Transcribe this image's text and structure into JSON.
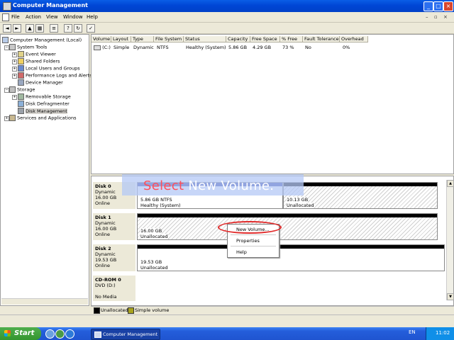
{
  "window": {
    "title": "Computer Management"
  },
  "menu": {
    "items": [
      "File",
      "Action",
      "View",
      "Window",
      "Help"
    ]
  },
  "tree": {
    "root": "Computer Management (Local)",
    "items": [
      {
        "label": "System Tools"
      },
      {
        "label": "Event Viewer"
      },
      {
        "label": "Shared Folders"
      },
      {
        "label": "Local Users and Groups"
      },
      {
        "label": "Performance Logs and Alerts"
      },
      {
        "label": "Device Manager"
      },
      {
        "label": "Storage"
      },
      {
        "label": "Removable Storage"
      },
      {
        "label": "Disk Defragmenter"
      },
      {
        "label": "Disk Management"
      },
      {
        "label": "Services and Applications"
      }
    ]
  },
  "volumes": {
    "headers": [
      "Volume",
      "Layout",
      "Type",
      "File System",
      "Status",
      "Capacity",
      "Free Space",
      "% Free",
      "Fault Tolerance",
      "Overhead"
    ],
    "rows": [
      [
        "(C:)",
        "Simple",
        "Dynamic",
        "NTFS",
        "Healthy (System)",
        "5.86 GB",
        "4.29 GB",
        "73 %",
        "No",
        "0%"
      ]
    ]
  },
  "disks": [
    {
      "name": "Disk 0",
      "type": "Dynamic",
      "size": "16.00 GB",
      "status": "Online",
      "partitions": [
        {
          "line1": "5.86 GB NTFS",
          "line2": "Healthy (System)"
        },
        {
          "line1": "10.13 GB",
          "line2": "Unallocated"
        }
      ]
    },
    {
      "name": "Disk 1",
      "type": "Dynamic",
      "size": "16.00 GB",
      "status": "Online",
      "partitions": [
        {
          "line1": "16.00 GB",
          "line2": "Unallocated"
        }
      ]
    },
    {
      "name": "Disk 2",
      "type": "Dynamic",
      "size": "19.53 GB",
      "status": "Online",
      "partitions": [
        {
          "line1": "19.53 GB",
          "line2": "Unallocated"
        }
      ]
    },
    {
      "name": "CD-ROM 0",
      "type": "DVD (D:)",
      "size": "",
      "status": "No Media",
      "partitions": []
    }
  ],
  "legend": {
    "unallocated": "Unallocated",
    "simple": "Simple volume"
  },
  "callout": {
    "prefix": "Select ",
    "highlight": "New Volume",
    "suffix": "."
  },
  "context_menu": {
    "items": [
      "New Volume...",
      "Properties",
      "Help"
    ]
  },
  "taskbar": {
    "start": "Start",
    "task": "Computer Management",
    "lang": "EN",
    "clock": "11:02"
  },
  "colors": {
    "accent": "#0046d5",
    "unallocated": "#000000",
    "simple_volume": "#a9a31e",
    "highlight_ring": "#e12b2b"
  }
}
